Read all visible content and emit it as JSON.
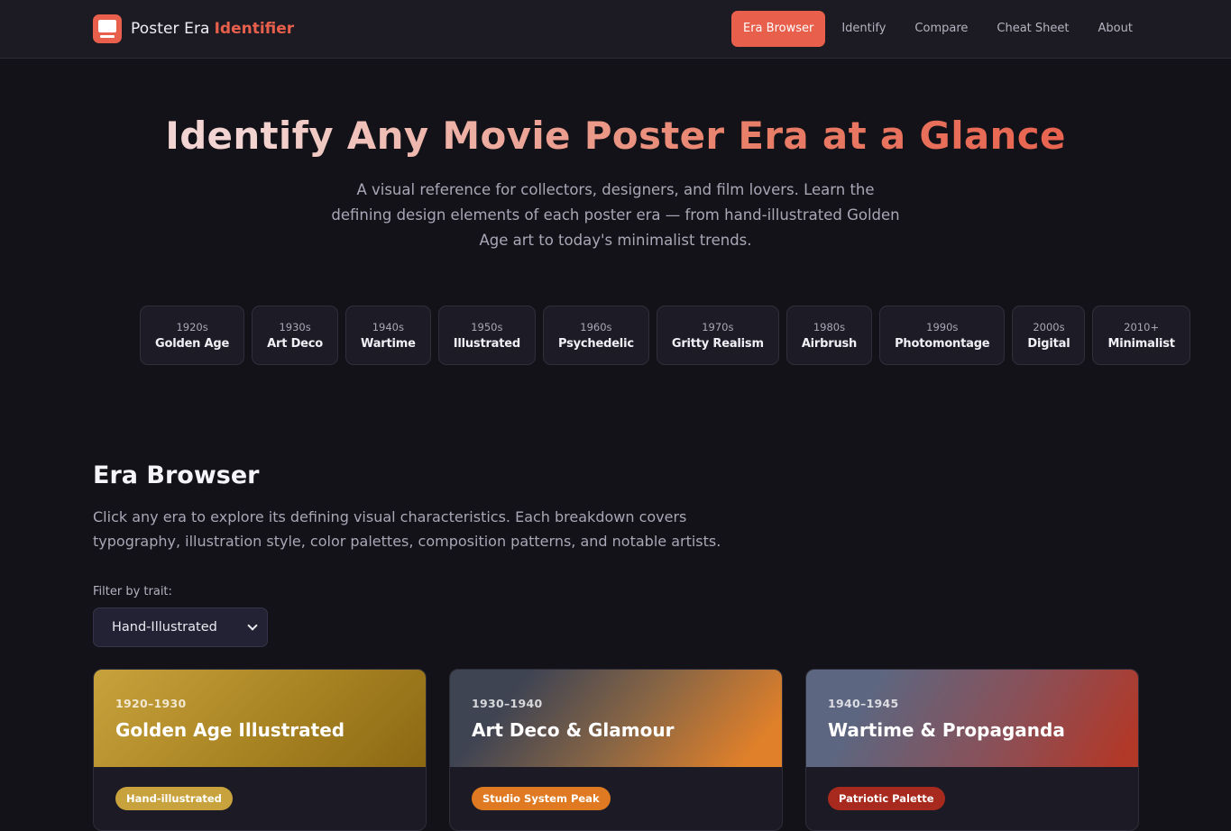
{
  "brand": {
    "name": "Poster Era",
    "accent": "Identifier",
    "logo_icon": "monitor-icon",
    "color": "#e8604c"
  },
  "nav": {
    "links": [
      {
        "label": "Era Browser",
        "active": true
      },
      {
        "label": "Identify"
      },
      {
        "label": "Compare"
      },
      {
        "label": "Cheat Sheet"
      },
      {
        "label": "About"
      }
    ]
  },
  "hero": {
    "title": "Identify Any Movie Poster Era at a Glance",
    "subtitle": "A visual reference for collectors, designers, and film lovers. Learn the defining design elements of each poster era — from hand-illustrated Golden Age art to today's minimalist trends."
  },
  "eras": [
    {
      "year": "1920s",
      "name": "Golden Age"
    },
    {
      "year": "1930s",
      "name": "Art Deco"
    },
    {
      "year": "1940s",
      "name": "Wartime"
    },
    {
      "year": "1950s",
      "name": "Illustrated"
    },
    {
      "year": "1960s",
      "name": "Psychedelic"
    },
    {
      "year": "1970s",
      "name": "Gritty Realism"
    },
    {
      "year": "1980s",
      "name": "Airbrush"
    },
    {
      "year": "1990s",
      "name": "Photomontage"
    },
    {
      "year": "2000s",
      "name": "Digital"
    },
    {
      "year": "2010+",
      "name": "Minimalist"
    }
  ],
  "browser": {
    "title": "Era Browser",
    "description": "Click any era to explore its defining visual characteristics. Each breakdown covers typography, illustration style, color palettes, composition patterns, and notable artists.",
    "filter_label": "Filter by trait:",
    "filter_value": "Hand-Illustrated"
  },
  "cards": [
    {
      "years": "1920–1930",
      "title": "Golden Age Illustrated",
      "badge": "Hand-illustrated",
      "badge_color": "#c8a23c"
    },
    {
      "years": "1930–1940",
      "title": "Art Deco & Glamour",
      "badge": "Studio System Peak",
      "badge_color": "#e07a22"
    },
    {
      "years": "1940–1945",
      "title": "Wartime & Propaganda",
      "badge": "Patriotic Palette",
      "badge_color": "#a82a1e"
    }
  ]
}
